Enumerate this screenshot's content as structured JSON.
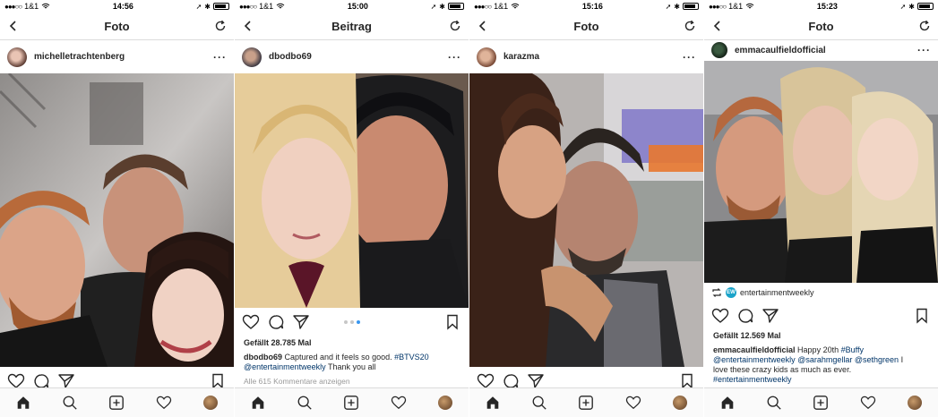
{
  "panels": [
    {
      "status": {
        "carrier": "1&1",
        "time": "14:56"
      },
      "nav_title": "Foto",
      "username": "michelletrachtenberg",
      "likes": "",
      "caption": {
        "user": "",
        "text": "",
        "tags": "",
        "extra": ""
      },
      "comments_link": ""
    },
    {
      "status": {
        "carrier": "1&1",
        "time": "15:00"
      },
      "nav_title": "Beitrag",
      "username": "dbodbo69",
      "likes": "Gefällt 28.785 Mal",
      "caption": {
        "user": "dbodbo69",
        "text": "Captured and it feels so good.",
        "tags": "#BTVS20",
        "extra_tag": "@entertainmentweekly",
        "extra": "Thank you all"
      },
      "comments_link": "Alle 615 Kommentare anzeigen"
    },
    {
      "status": {
        "carrier": "1&1",
        "time": "15:16"
      },
      "nav_title": "Foto",
      "username": "karazma",
      "likes": "",
      "caption": {
        "user": "",
        "text": "",
        "tags": "",
        "extra": ""
      },
      "comments_link": ""
    },
    {
      "status": {
        "carrier": "1&1",
        "time": "15:23"
      },
      "nav_title": "Foto",
      "username": "emmacaulfieldofficial",
      "repost_user": "entertainmentweekly",
      "likes": "Gefällt 12.569 Mal",
      "caption": {
        "user": "emmacaulfieldofficial",
        "text": "Happy 20th",
        "tag1": "#Buffy",
        "tag2": "@entertainmentweekly",
        "tag3": "@sarahmgellar",
        "tag4": "@sethgreen",
        "after": "I",
        "line3": "love these crazy kids as much as ever.",
        "tag5": "#entertainmentweekly"
      },
      "comments_link": ""
    }
  ],
  "icons": {
    "back": "chevron-left-icon",
    "refresh": "refresh-icon",
    "like": "heart-icon",
    "comment": "comment-icon",
    "share": "direct-share-icon",
    "save": "bookmark-icon",
    "home": "home-icon",
    "search": "search-icon",
    "add": "add-post-icon",
    "activity": "activity-heart-icon",
    "profile": "profile-avatar"
  },
  "colors": {
    "link": "#003569",
    "pager_active": "#3897f0",
    "divider": "#dbdbdb"
  }
}
